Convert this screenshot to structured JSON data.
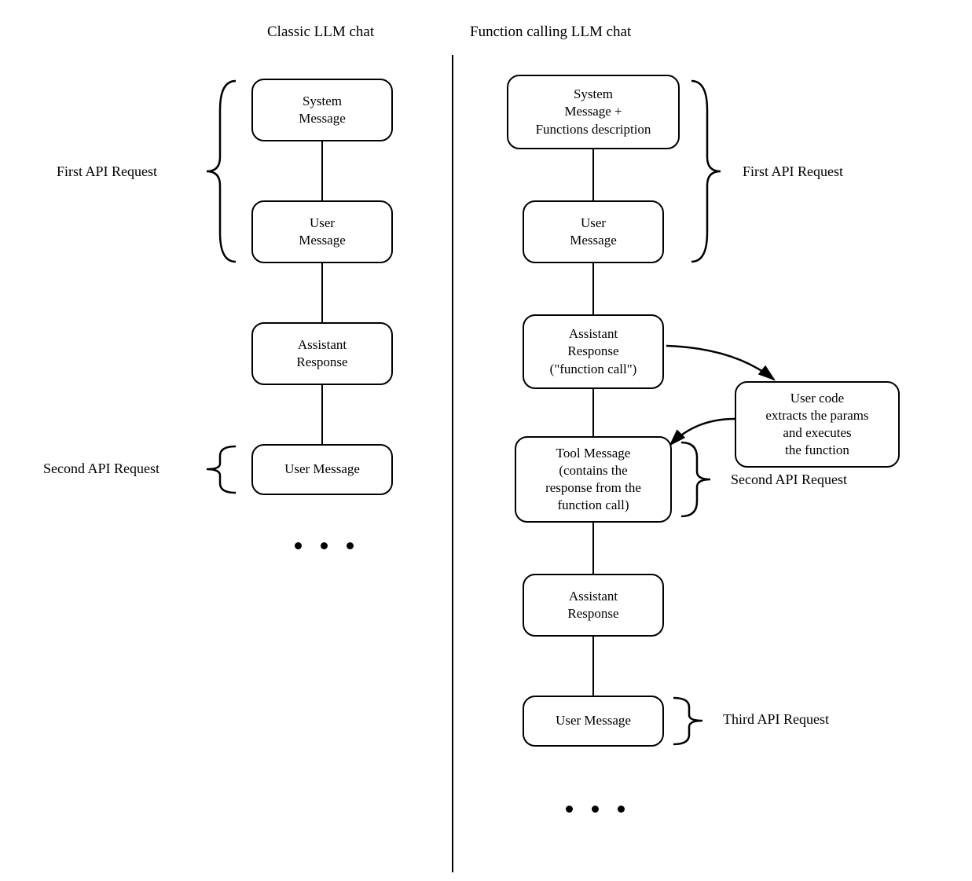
{
  "left": {
    "title": "Classic LLM chat",
    "boxes": {
      "system": "System\nMessage",
      "user1": "User\nMessage",
      "assistant": "Assistant\nResponse",
      "user2": "User Message"
    },
    "labels": {
      "first": "First API Request",
      "second": "Second API Request"
    }
  },
  "right": {
    "title": "Function calling LLM chat",
    "boxes": {
      "system": "System\nMessage +\nFunctions description",
      "user1": "User\nMessage",
      "assistant_fc": "Assistant\nResponse\n(\"function call\")",
      "usercode": "User code\nextracts the params\nand executes\nthe function",
      "tool": "Tool Message\n(contains the\nresponse from the\nfunction call)",
      "assistant": "Assistant\nResponse",
      "user2": "User Message"
    },
    "labels": {
      "first": "First API Request",
      "second": "Second API Request",
      "third": "Third API Request"
    }
  }
}
